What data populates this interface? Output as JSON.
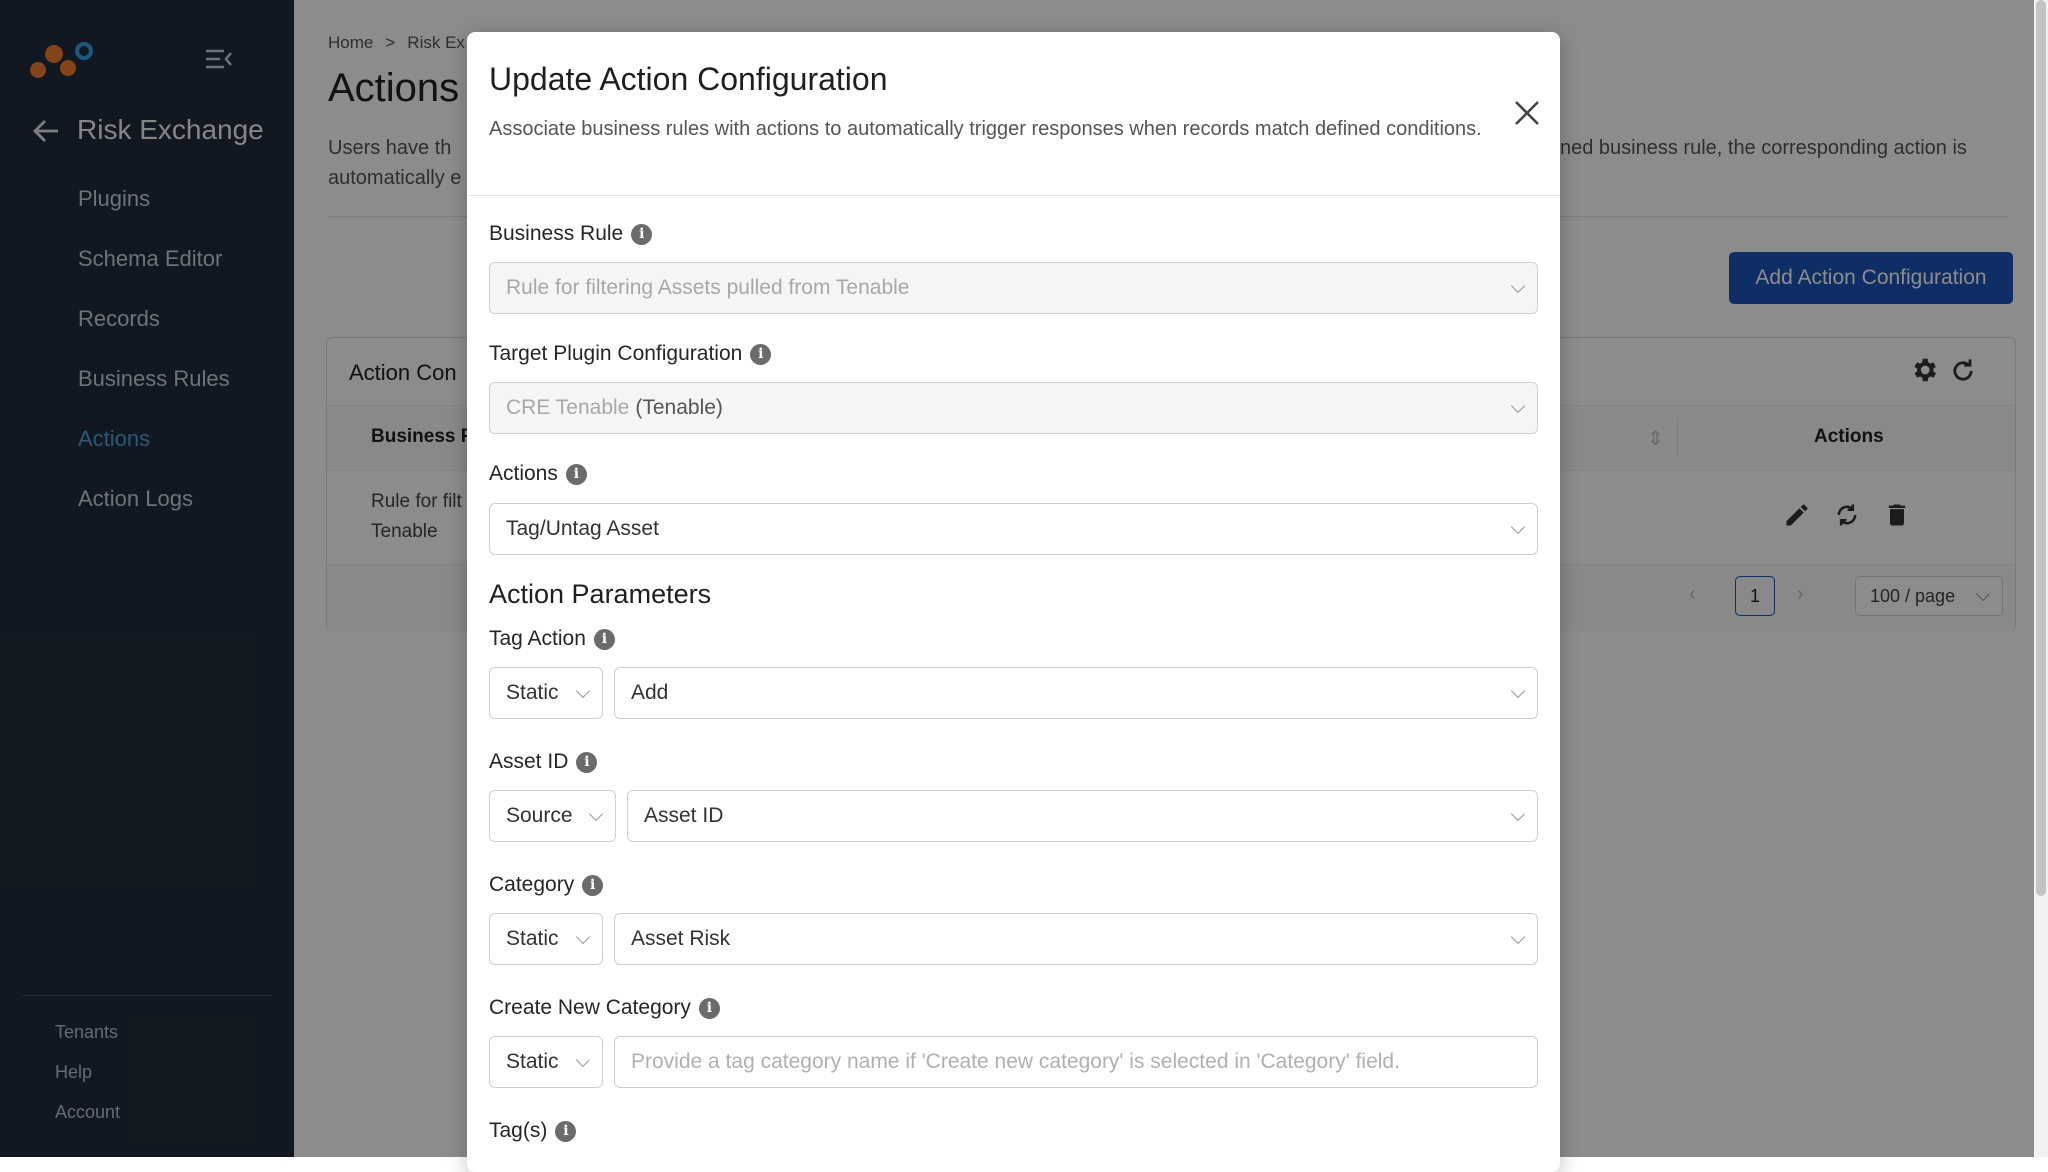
{
  "sidebar": {
    "title": "Risk Exchange",
    "items": [
      {
        "label": "Plugins",
        "active": false
      },
      {
        "label": "Schema Editor",
        "active": false
      },
      {
        "label": "Records",
        "active": false
      },
      {
        "label": "Business Rules",
        "active": false
      },
      {
        "label": "Actions",
        "active": true
      },
      {
        "label": "Action Logs",
        "active": false
      }
    ],
    "footer": [
      "Tenants",
      "Help",
      "Account"
    ]
  },
  "main": {
    "breadcrumb": [
      "Home",
      ">",
      "Risk Ex"
    ],
    "title": "Actions",
    "description_left_1": "Users have th",
    "description_left_2": "automatically e",
    "description_right": "ned business rule, the corresponding action is",
    "add_button": "Add Action Configuration",
    "card_title": "Action Con",
    "table": {
      "col_business": "Business R",
      "col_actions": "Actions",
      "row_cell_1": "Rule for filt",
      "row_cell_2": "Tenable"
    },
    "pagination": {
      "current_page": "1",
      "page_size": "100 / page"
    }
  },
  "modal": {
    "title": "Update Action Configuration",
    "subtitle": "Associate business rules with actions to automatically trigger responses when records match defined conditions.",
    "business_rule": {
      "label": "Business Rule",
      "value": "Rule for filtering Assets pulled from Tenable"
    },
    "target_plugin": {
      "label": "Target Plugin Configuration",
      "value": "CRE Tenable",
      "suffix": "(Tenable)"
    },
    "actions": {
      "label": "Actions",
      "value": "Tag/Untag Asset"
    },
    "params_heading": "Action Parameters",
    "tag_action": {
      "label": "Tag Action",
      "mode": "Static",
      "value": "Add"
    },
    "asset_id": {
      "label": "Asset ID",
      "mode": "Source",
      "value": "Asset ID"
    },
    "category": {
      "label": "Category",
      "mode": "Static",
      "value": "Asset Risk"
    },
    "create_category": {
      "label": "Create New Category",
      "mode": "Static",
      "placeholder": "Provide a tag category name if 'Create new category' is selected in 'Category' field."
    },
    "tags": {
      "label": "Tag(s)"
    }
  },
  "colors": {
    "sidebar_bg": "#1f2d3d",
    "accent": "#4ea1d8",
    "primary_button": "#1a55b8"
  }
}
